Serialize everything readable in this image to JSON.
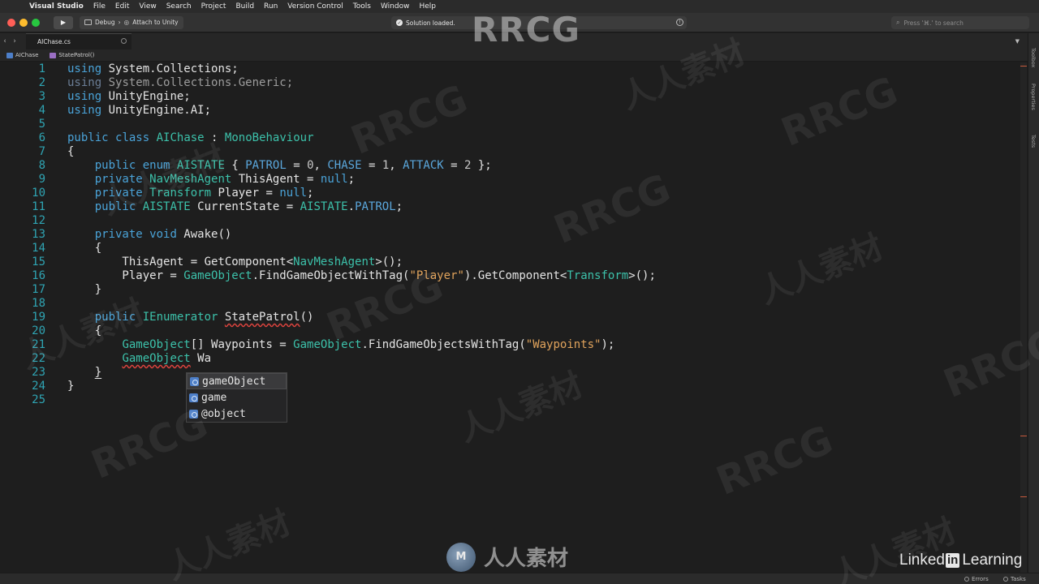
{
  "menubar": {
    "app_name": "Visual Studio",
    "items": [
      "File",
      "Edit",
      "View",
      "Search",
      "Project",
      "Build",
      "Run",
      "Version Control",
      "Tools",
      "Window",
      "Help"
    ]
  },
  "toolbar": {
    "configuration": "Debug",
    "target": "Attach to Unity",
    "status": "Solution loaded.",
    "search_placeholder": "Press '⌘.' to search"
  },
  "tab": {
    "label": "AIChase.cs"
  },
  "breadcrumb": {
    "class_name": "AIChase",
    "method_name": "StatePatrol()"
  },
  "sidebar": {
    "toolbox": "Toolbox",
    "properties": "Properties",
    "tests": "Tests"
  },
  "editor": {
    "line_numbers": [
      "1",
      "2",
      "3",
      "4",
      "5",
      "6",
      "7",
      "8",
      "9",
      "10",
      "11",
      "12",
      "13",
      "14",
      "15",
      "16",
      "17",
      "18",
      "19",
      "20",
      "21",
      "22",
      "23",
      "24",
      "25"
    ]
  },
  "completion": {
    "items": [
      "gameObject",
      "game",
      "@object"
    ],
    "selected_index": 0
  },
  "statusbar": {
    "errors": "Errors",
    "tasks": "Tasks"
  },
  "watermark": {
    "top": "RRCG",
    "logo_text": "人人素材",
    "brand": "Linked",
    "brand_in": "in",
    "brand_suffix": "Learning"
  }
}
